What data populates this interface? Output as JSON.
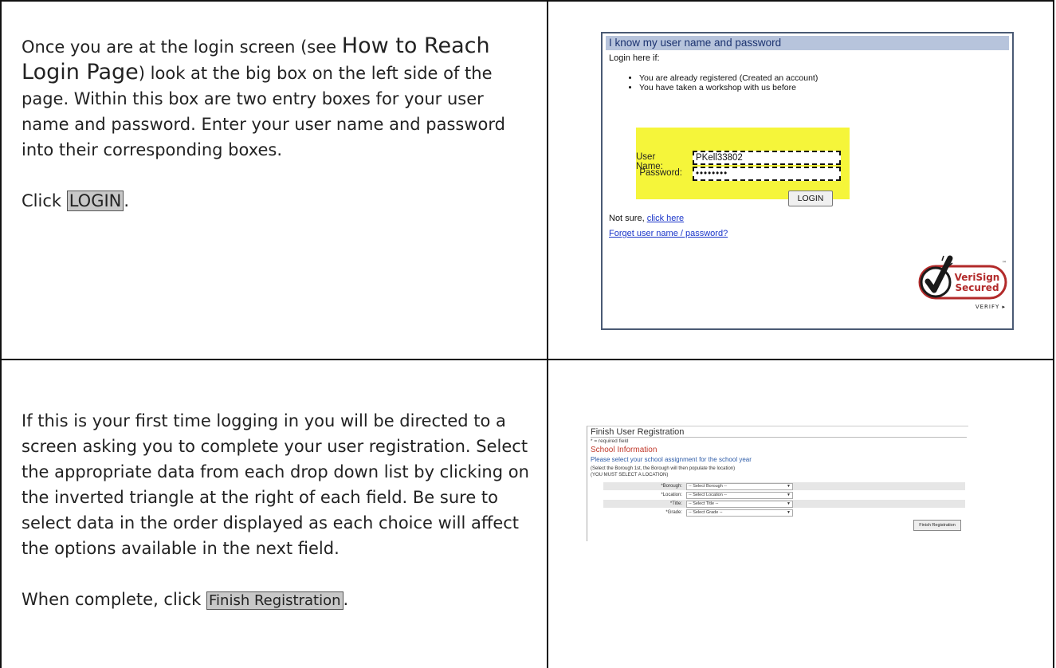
{
  "step1": {
    "text_pre": "Once you are at the login screen (see ",
    "link_text": "How to Reach Login Page",
    "text_post": ") look at the big box on the left side of the page. Within this box are two entry boxes for your user name and password. Enter your user name and password into their corresponding boxes.",
    "click_prefix": "Click ",
    "button_ref": "LOGIN",
    "click_suffix": "."
  },
  "login_shot": {
    "header": "I know my user name and password",
    "subheader": "Login here if:",
    "bullets": [
      "You are already registered (Created an account)",
      "You have taken a workshop with us before"
    ],
    "username_label": "User Name:",
    "username_value": "PKell33802",
    "password_label": "Password:",
    "password_value": "••••••••",
    "login_button": "LOGIN",
    "not_sure_text": "Not sure, ",
    "not_sure_link": "click here",
    "forget_link": "Forget user name / password?",
    "seal": {
      "line1": "VeriSign",
      "line2": "Secured",
      "verify": "VERIFY ▸",
      "tm": "™"
    }
  },
  "step2": {
    "text": "If this is your first time logging in you will be directed to a screen asking you to complete your user registration. Select the appropriate data from each drop down list by clicking on the inverted triangle at the right of each field. Be sure to select data in the order displayed as each choice will affect the options available in the next field.",
    "complete_prefix": "When complete, click ",
    "button_ref": "Finish Registration",
    "complete_suffix": "."
  },
  "reg_shot": {
    "title": "Finish User Registration",
    "required_note": "* = required field",
    "section_title": "School Information",
    "instruction": "Please select your school assignment for the school year",
    "note1": "(Select the Borough 1st, the Borough will then populate the location)",
    "note2": "(YOU MUST SELECT A LOCATION)",
    "fields": [
      {
        "label": "*Borough:",
        "placeholder": "-- Select Borough --"
      },
      {
        "label": "*Location:",
        "placeholder": "-- Select Location --"
      },
      {
        "label": "*Title:",
        "placeholder": "-- Select Title --"
      },
      {
        "label": "*Grade:",
        "placeholder": "-- Select Grade --"
      }
    ],
    "finish_button": "Finish Registration"
  },
  "colors": {
    "border": "#111111",
    "button_ref_bg": "#c8c8c8",
    "login_header_bg": "#b7c4dc",
    "highlight_yellow": "#f5f53a",
    "link_blue": "#1a35c9",
    "seal_red": "#b22a2a"
  }
}
